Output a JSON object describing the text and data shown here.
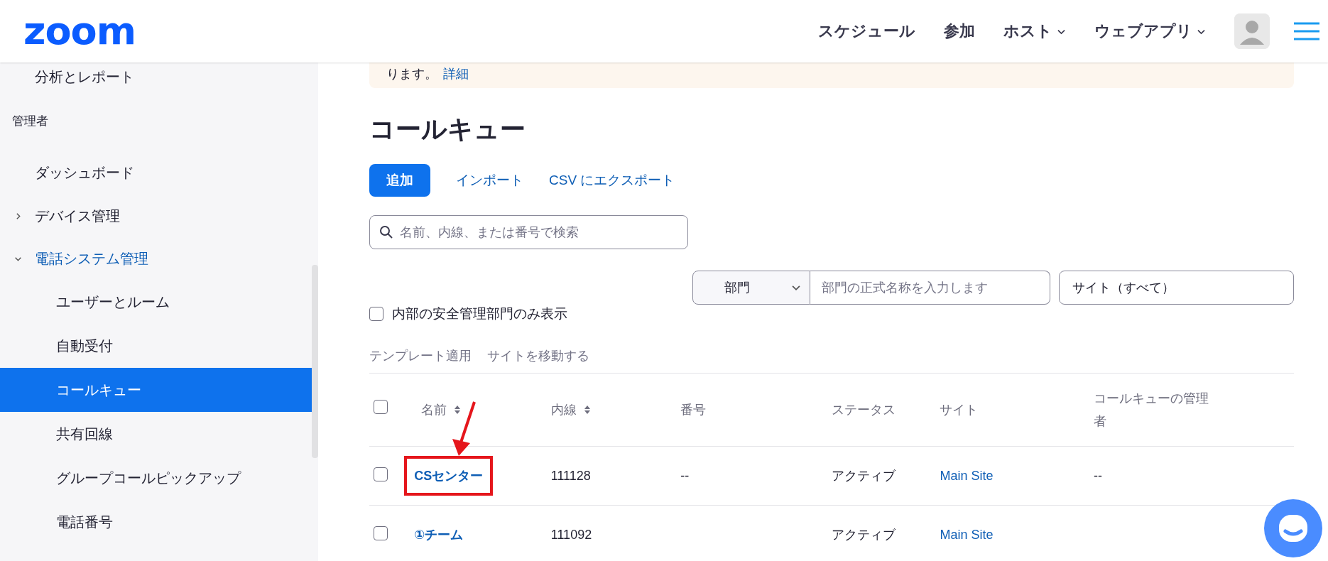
{
  "header": {
    "logo": "zoom",
    "nav": [
      {
        "label": "スケジュール",
        "dropdown": false
      },
      {
        "label": "参加",
        "dropdown": false
      },
      {
        "label": "ホスト",
        "dropdown": true
      },
      {
        "label": "ウェブアプリ",
        "dropdown": true
      }
    ]
  },
  "sidebar": {
    "items": [
      {
        "label": "分析とレポート",
        "kind": "link",
        "selected": false
      },
      {
        "label": "管理者",
        "kind": "section"
      },
      {
        "label": "ダッシュボード",
        "kind": "link",
        "selected": false
      },
      {
        "label": "デバイス管理",
        "kind": "group",
        "expanded": false
      },
      {
        "label": "電話システム管理",
        "kind": "group",
        "expanded": true,
        "children": [
          {
            "label": "ユーザーとルーム",
            "kind": "link",
            "selected": false
          },
          {
            "label": "自動受付",
            "kind": "link",
            "selected": false
          },
          {
            "label": "コールキュー",
            "kind": "link",
            "selected": true
          },
          {
            "label": "共有回線",
            "kind": "link",
            "selected": false
          },
          {
            "label": "グループコールピックアップ",
            "kind": "link",
            "selected": false
          },
          {
            "label": "電話番号",
            "kind": "link",
            "selected": false
          }
        ]
      }
    ]
  },
  "notice": {
    "text": "ります。",
    "link": "詳細"
  },
  "page_title": "コールキュー",
  "actions": [
    {
      "label": "追加",
      "kind": "primary"
    },
    {
      "label": "インポート",
      "kind": "link"
    },
    {
      "label": "CSV にエクスポート",
      "kind": "link"
    }
  ],
  "search": {
    "placeholder": "名前、内線、または番号で検索"
  },
  "filters": {
    "type_select": "部門",
    "name_input": {
      "placeholder": "部門の正式名称を入力します"
    },
    "site_select": "サイト（すべて）"
  },
  "internal_only": {
    "label": "内部の安全管理部門のみ表示",
    "checked": false
  },
  "bulk_actions": [
    {
      "label": "テンプレート適用",
      "disabled": true
    },
    {
      "label": "サイトを移動する",
      "disabled": true
    }
  ],
  "table": {
    "all_checked": false,
    "columns": [
      {
        "label": "名前",
        "sortable": true
      },
      {
        "label": "内線",
        "sortable": true
      },
      {
        "label": "番号",
        "sortable": false
      },
      {
        "label": "ステータス",
        "sortable": false
      },
      {
        "label": "サイト",
        "sortable": false
      },
      {
        "label": "コールキューの管理者",
        "sortable": false
      }
    ],
    "rows": [
      {
        "checked": false,
        "highlighted": true,
        "name": "CSセンター",
        "extension": "111128",
        "number": "--",
        "status": "アクティブ",
        "site": "Main Site",
        "manager": "--"
      },
      {
        "checked": false,
        "highlighted": false,
        "name": "①チーム",
        "extension": "111092",
        "status": "アクティブ",
        "site": "Main Site"
      }
    ]
  }
}
